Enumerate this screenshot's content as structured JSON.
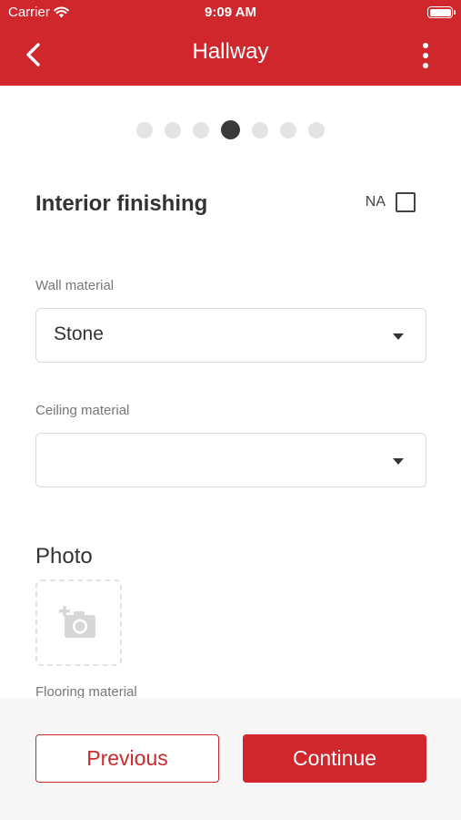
{
  "status_bar": {
    "carrier": "Carrier",
    "time": "9:09 AM"
  },
  "header": {
    "title": "Hallway",
    "back_icon": "chevron-left-icon",
    "menu_icon": "more-vertical-icon"
  },
  "pager": {
    "total": 7,
    "current": 4
  },
  "section": {
    "title": "Interior finishing",
    "na_label": "NA",
    "na_checked": false
  },
  "fields": {
    "wall": {
      "label": "Wall material",
      "value": "Stone"
    },
    "ceiling": {
      "label": "Ceiling material",
      "value": ""
    }
  },
  "photo": {
    "title": "Photo",
    "add_icon": "add-photo-icon"
  },
  "flooring": {
    "label": "Flooring material"
  },
  "footer": {
    "previous_label": "Previous",
    "continue_label": "Continue"
  },
  "colors": {
    "brand": "#d0272d",
    "active_dot": "#3a3a3a",
    "inactive_dot": "#e4e4e4"
  }
}
